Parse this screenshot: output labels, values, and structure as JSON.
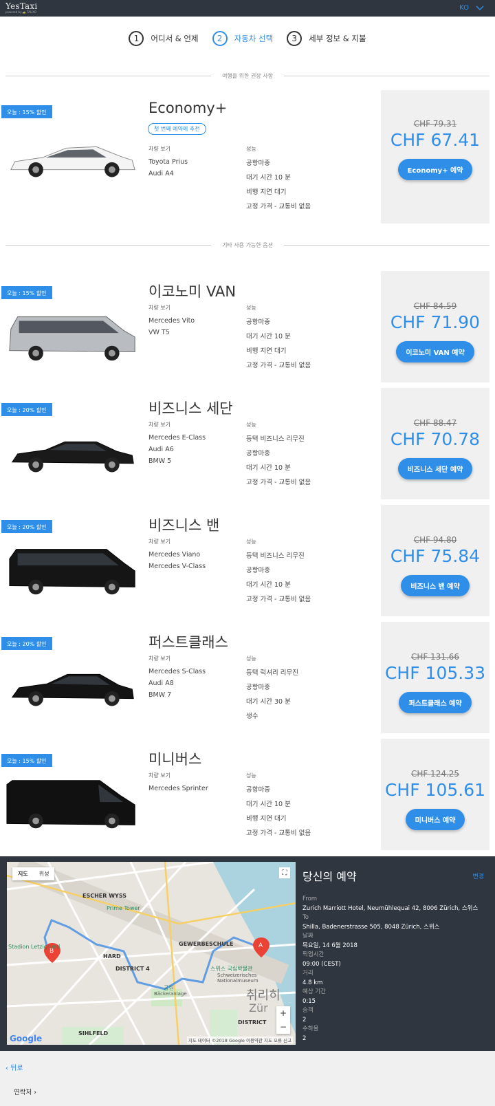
{
  "header": {
    "logo": "YesTaxi",
    "logo_sub": "powered by 🚕 TALIXO",
    "lang": "KO"
  },
  "steps": [
    {
      "num": "1",
      "label": "어디서 & 언제"
    },
    {
      "num": "2",
      "label": "자동차 선택"
    },
    {
      "num": "3",
      "label": "세부 정보 & 지불"
    }
  ],
  "sections": {
    "recommended": "여행을 위한 권장 사항",
    "other": "기타 사용 가능한 옵션"
  },
  "models_heading": "차량 보기",
  "features_heading": "성능",
  "cars": [
    {
      "badge": "오늘 : 15% 할인",
      "title": "Economy+",
      "recommend": "첫 번째 예약에 추천",
      "models": [
        "Toyota Prius",
        "Audi A4"
      ],
      "features": [
        "공항마중",
        "대기 시간 10 분",
        "비행 지연 대기",
        "고정 가격 - 교통비 없음"
      ],
      "old_price": "CHF 79.31",
      "price": "CHF 67.41",
      "button": "Economy+ 예약"
    },
    {
      "badge": "오늘 : 15% 할인",
      "title": "이코노미 VAN",
      "models": [
        "Mercedes Vito",
        "VW T5"
      ],
      "features": [
        "공항마중",
        "대기 시간 10 분",
        "비행 지연 대기",
        "고정 가격 - 교통비 없음"
      ],
      "old_price": "CHF 84.59",
      "price": "CHF 71.90",
      "button": "이코노미 VAN 예약"
    },
    {
      "badge": "오늘 : 20% 할인",
      "title": "비즈니스 세단",
      "models": [
        "Mercedes E-Class",
        "Audi A6",
        "BMW 5"
      ],
      "features": [
        "등택 비즈니스 리무진",
        "공항마중",
        "대기 시간 10 분",
        "고정 가격 - 교통비 없음"
      ],
      "old_price": "CHF 88.47",
      "price": "CHF 70.78",
      "button": "비즈니스 세단 예약"
    },
    {
      "badge": "오늘 : 20% 할인",
      "title": "비즈니스 밴",
      "models": [
        "Mercedes Viano",
        "Mercedes V-Class"
      ],
      "features": [
        "등택 비즈니스 리무진",
        "공항마중",
        "대기 시간 10 분",
        "고정 가격 - 교통비 없음"
      ],
      "old_price": "CHF 94.80",
      "price": "CHF 75.84",
      "button": "비즈니스 밴 예약"
    },
    {
      "badge": "오늘 : 20% 할인",
      "title": "퍼스트클래스",
      "models": [
        "Mercedes S-Class",
        "Audi A8",
        "BMW 7"
      ],
      "features": [
        "등택 럭셔리 리무진",
        "공항마중",
        "대기 시간 30 분",
        "생수"
      ],
      "old_price": "CHF 131.66",
      "price": "CHF 105.33",
      "button": "퍼스트클래스 예약"
    },
    {
      "badge": "오늘 : 15% 할인",
      "title": "미니버스",
      "models": [
        "Mercedes Sprinter"
      ],
      "features": [
        "공항마중",
        "대기 시간 10 분",
        "비행 지연 대기",
        "고정 가격 - 교통비 없음"
      ],
      "old_price": "CHF 124.25",
      "price": "CHF 105.61",
      "button": "미니버스 예약"
    }
  ],
  "map": {
    "tab_map": "지도",
    "tab_sat": "위성",
    "labels": {
      "escher": "ESCHER WYSS",
      "prime": "Prime Tower",
      "gewerbe": "GEWERBESCHULE",
      "hard": "HARD",
      "district4": "DISTRICT 4",
      "museum1": "스위스 국립박물관",
      "museum2": "Schweizerisches",
      "museum3": "Nationalmuseum",
      "park1": "공원",
      "park2": "Bäckeranlage",
      "stadion": "Stadion Letzigrund",
      "sihlfeld": "SIHLFELD",
      "zurich": "취리히",
      "district": "DISTRICT",
      "zur": "Zür"
    },
    "google": "Google",
    "footer": "지도 데이터 ©2018 Google   이용약관   지도 오류 신고",
    "zoom_in": "+",
    "zoom_out": "−"
  },
  "booking": {
    "title": "당신의 예약",
    "change": "변경",
    "from_label": "From",
    "from": "Zurich Marriott Hotel, Neumühlequai 42, 8006 Zürich, 스위스",
    "to_label": "To",
    "to": "Shilla, Badenerstrasse 505, 8048 Zürich, 스위스",
    "date_label": "날짜",
    "date": "목요일, 14 6월 2018",
    "pickup_label": "픽업시간",
    "pickup": "09:00 (CEST)",
    "distance_label": "거리",
    "distance": "4.8 km",
    "duration_label": "예상 기간",
    "duration": "0:15",
    "passengers_label": "승객",
    "passengers": "2",
    "luggage_label": "수하물",
    "luggage": "2"
  },
  "footer": {
    "back": "‹ 뒤로",
    "contact": "연락처 ›"
  }
}
